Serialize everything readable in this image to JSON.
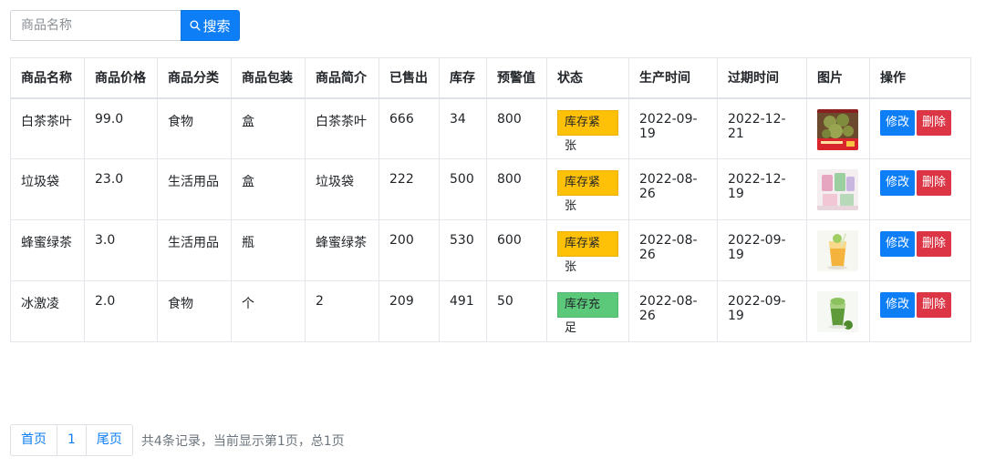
{
  "search": {
    "placeholder": "商品名称",
    "button_label": "搜索",
    "button_color": "#0d7ef5"
  },
  "table": {
    "headers": [
      "商品名称",
      "商品价格",
      "商品分类",
      "商品包装",
      "商品简介",
      "已售出",
      "库存",
      "预警值",
      "状态",
      "生产时间",
      "过期时间",
      "图片",
      "操作"
    ],
    "rows": [
      {
        "name": "白茶茶叶",
        "price": "99.0",
        "category": "食物",
        "package": "盒",
        "intro": "白茶茶叶",
        "sold": "666",
        "stock": "34",
        "warning": "800",
        "status": "库存紧张",
        "status_color": "#ffc107",
        "produced": "2022-09-19",
        "expires": "2022-12-21",
        "image_icon": "tea-cakes-image"
      },
      {
        "name": "垃圾袋",
        "price": "23.0",
        "category": "生活用品",
        "package": "盒",
        "intro": "垃圾袋",
        "sold": "222",
        "stock": "500",
        "warning": "800",
        "status": "库存紧张",
        "status_color": "#ffc107",
        "produced": "2022-08-26",
        "expires": "2022-12-19",
        "image_icon": "garbage-bags-image"
      },
      {
        "name": "蜂蜜绿茶",
        "price": "3.0",
        "category": "生活用品",
        "package": "瓶",
        "intro": "蜂蜜绿茶",
        "sold": "200",
        "stock": "530",
        "warning": "600",
        "status": "库存紧张",
        "status_color": "#ffc107",
        "produced": "2022-08-26",
        "expires": "2022-09-19",
        "image_icon": "honey-green-tea-image"
      },
      {
        "name": "冰激凌",
        "price": "2.0",
        "category": "食物",
        "package": "个",
        "intro": "2",
        "sold": "209",
        "stock": "491",
        "warning": "50",
        "status": "库存充足",
        "status_color": "#5cc87a",
        "produced": "2022-08-26",
        "expires": "2022-09-19",
        "image_icon": "matcha-drink-image"
      }
    ],
    "edit_label": "修改",
    "delete_label": "删除",
    "edit_color": "#0d7ef5",
    "delete_color": "#dc3545"
  },
  "pagination": {
    "first_label": "首页",
    "current_page": "1",
    "last_label": "尾页",
    "info": "共4条记录，当前显示第1页，总1页"
  }
}
